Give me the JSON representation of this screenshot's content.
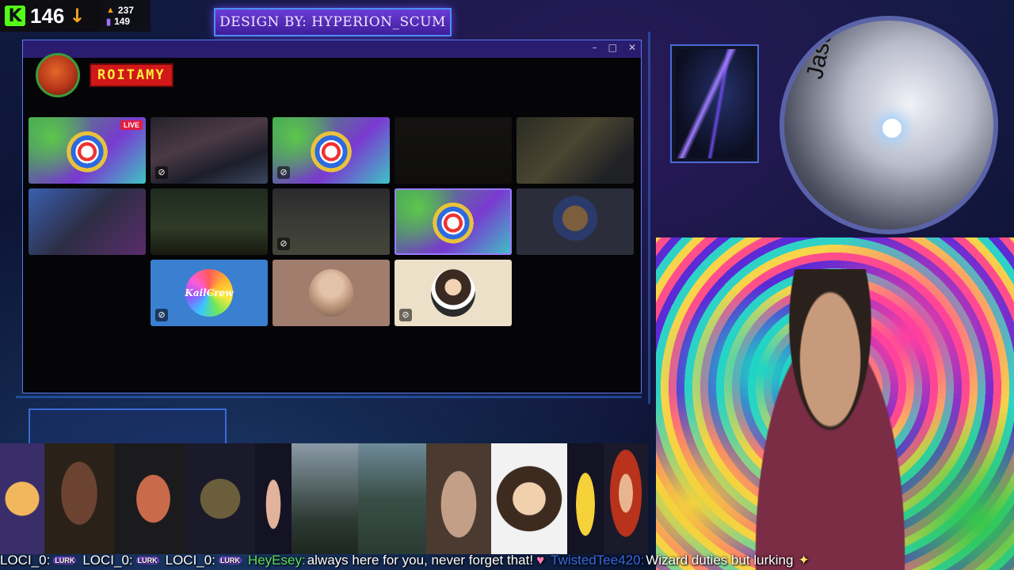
{
  "stats": {
    "kick_count": "146",
    "stat_orange": "237",
    "stat_purple": "149"
  },
  "banner": {
    "text": "DESIGN BY: HYPERION_SCUM"
  },
  "window": {
    "controls": [
      "–",
      "□",
      "✕"
    ],
    "channel_name": "ROITAMY",
    "live_label": "LIVE",
    "kail_label": "KailCrew"
  },
  "camera": {
    "ring_text": "Jason derulo"
  },
  "chat": {
    "messages": [
      {
        "user": "LOCI_0:",
        "text": "",
        "emote": "LURK"
      },
      {
        "user": "LOCI_0:",
        "text": "",
        "emote": "LURK"
      },
      {
        "user": "LOCI_0:",
        "text": "",
        "emote": "LURK"
      },
      {
        "user": "HeyEsey:",
        "text": "always here for you, never forget that!",
        "emote": ""
      },
      {
        "user": "TwistedTee420:",
        "text": "Wizard duties but lurking",
        "emote": ""
      }
    ]
  },
  "colors": {
    "kick_green": "#53fc18",
    "banner_purple": "#6b3cd6",
    "live_red": "#e41e3f",
    "heyesey_green": "#5ee05e",
    "twisted_blue": "#3a6ae0"
  }
}
